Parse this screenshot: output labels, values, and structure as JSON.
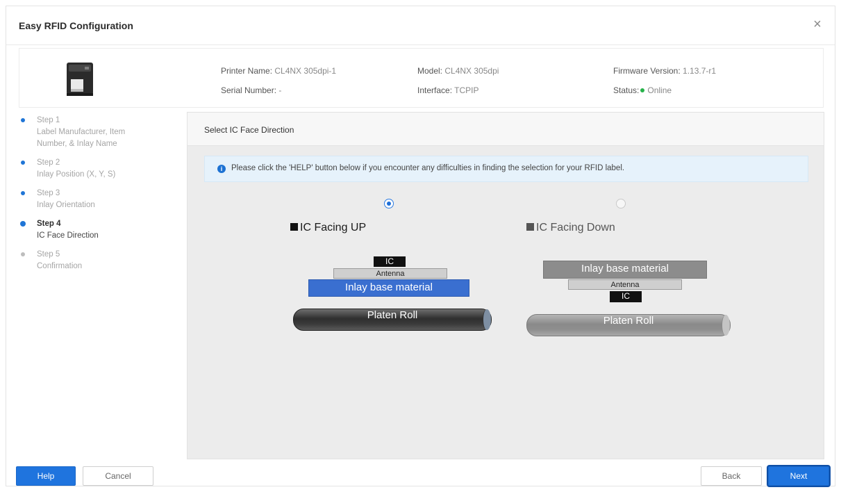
{
  "window": {
    "title": "Easy RFID Configuration",
    "close_glyph": "×"
  },
  "printer_info": {
    "printer_name_label": "Printer Name:",
    "printer_name": "CL4NX 305dpi-1",
    "serial_label": "Serial Number:",
    "serial": "-",
    "model_label": "Model:",
    "model": "CL4NX 305dpi",
    "interface_label": "Interface:",
    "interface": "TCPIP",
    "firmware_label": "Firmware Version:",
    "firmware": "1.13.7-r1",
    "status_label": "Status:",
    "status": "Online",
    "status_color": "#27b24a"
  },
  "steps": [
    {
      "title": "Step 1",
      "sub": "Label Manufacturer, Item Number, & Inlay Name",
      "state": "done"
    },
    {
      "title": "Step 2",
      "sub": "Inlay Position (X, Y, S)",
      "state": "done"
    },
    {
      "title": "Step 3",
      "sub": "Inlay Orientation",
      "state": "done"
    },
    {
      "title": "Step 4",
      "sub": "IC Face Direction",
      "state": "active"
    },
    {
      "title": "Step 5",
      "sub": "Confirmation",
      "state": "pending"
    }
  ],
  "content": {
    "header": "Select IC Face Direction",
    "notice_icon": "i",
    "notice": "Please click the 'HELP' button below if you encounter any difficulties in finding the selection for your RFID label.",
    "option_up": {
      "title": "IC Facing UP",
      "selected": true,
      "ic": "IC",
      "antenna": "Antenna",
      "inlay": "Inlay base material",
      "platen": "Platen Roll"
    },
    "option_down": {
      "title": "IC Facing Down",
      "selected": false,
      "ic": "IC",
      "antenna": "Antenna",
      "inlay": "Inlay base material",
      "platen": "Platen Roll"
    }
  },
  "footer": {
    "help": "Help",
    "cancel": "Cancel",
    "back": "Back",
    "next": "Next"
  },
  "colors": {
    "accent": "#1f74de",
    "inlay_up": "#3a6fd0"
  }
}
